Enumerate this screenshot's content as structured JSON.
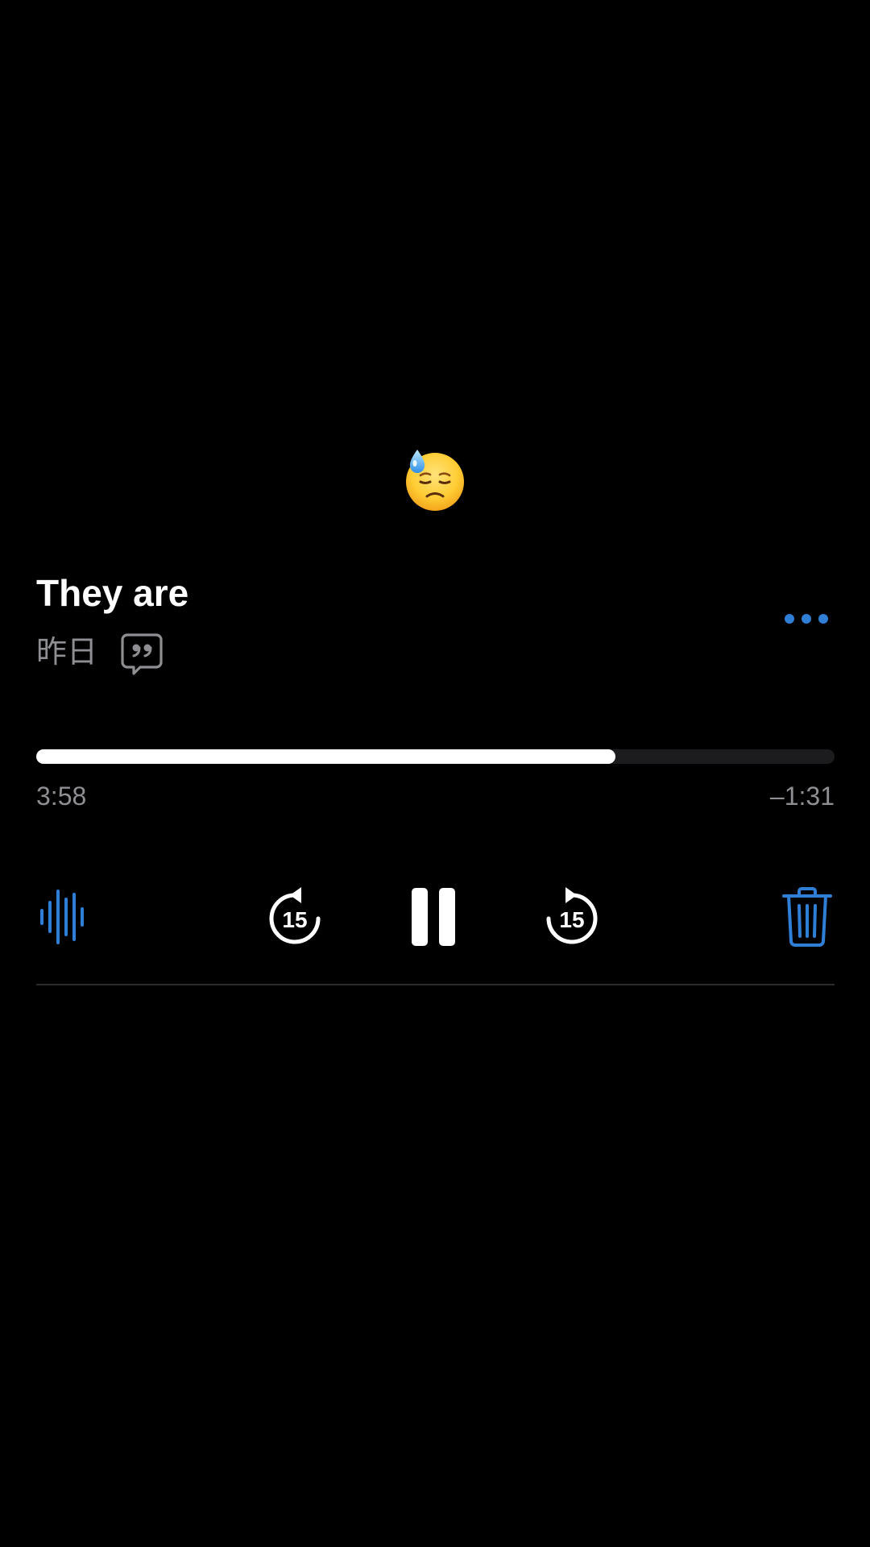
{
  "recording": {
    "emoji": "downcast-face-with-sweat",
    "title": "They are",
    "date": "昨日"
  },
  "playback": {
    "elapsed": "3:58",
    "remaining": "–1:31",
    "progress_fraction": 0.726,
    "skip_back_seconds": "15",
    "skip_forward_seconds": "15"
  },
  "icons": {
    "transcript": "quote-bubble-icon",
    "more": "ellipsis-icon",
    "waveform": "waveform-icon",
    "skip_back": "gobackward-15-icon",
    "pause": "pause-icon",
    "skip_forward": "goforward-15-icon",
    "delete": "trash-icon"
  },
  "colors": {
    "background": "#000000",
    "accent": "#2f7fd6",
    "secondary_text": "#8e8e93",
    "progress_track": "#1c1c1e",
    "progress_fill": "#ffffff"
  }
}
